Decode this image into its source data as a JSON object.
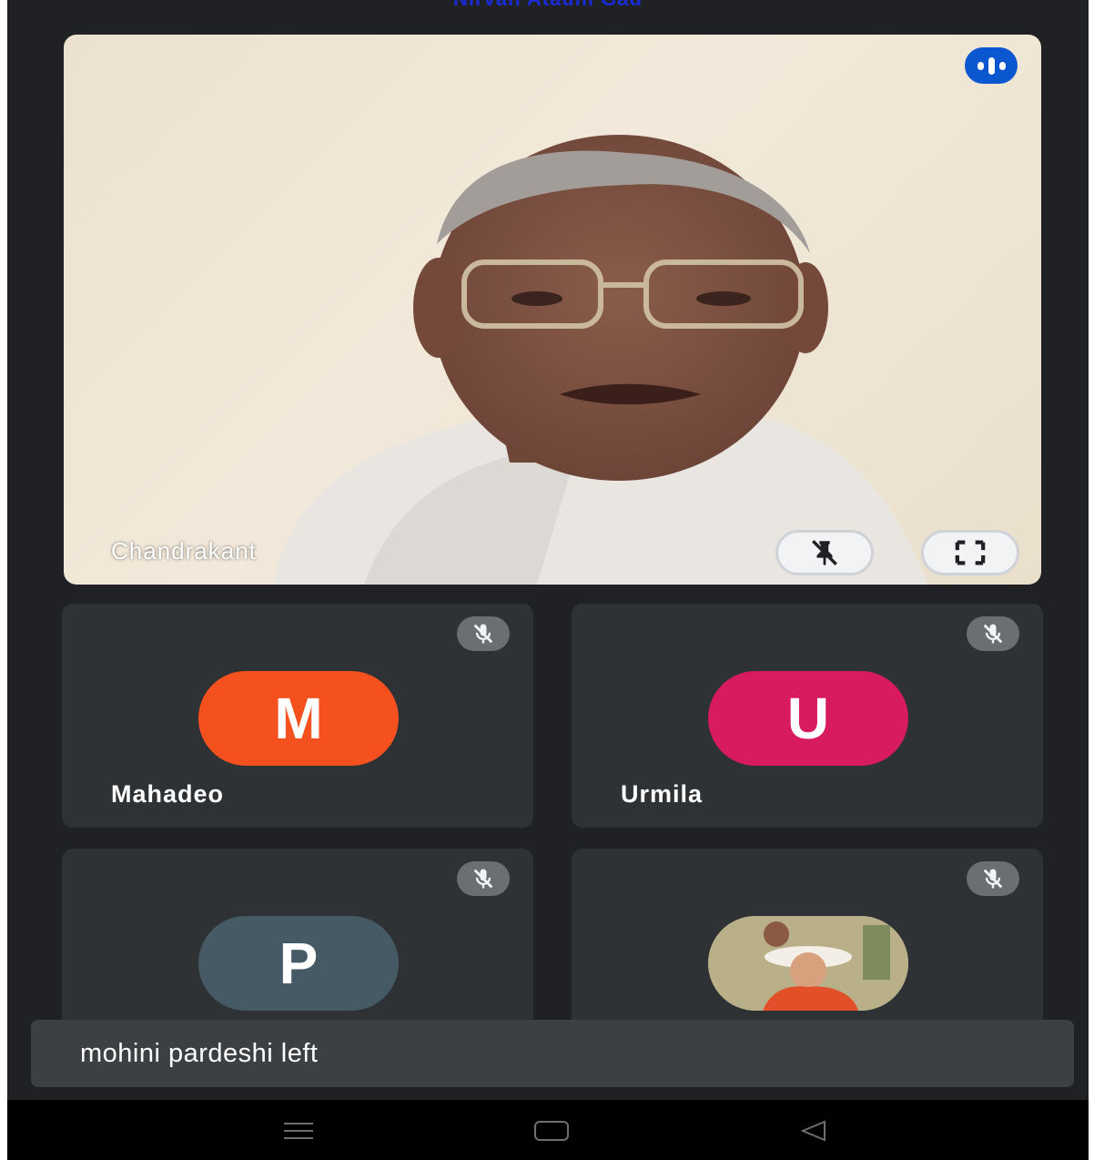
{
  "header": {
    "caption": "Nirvan Ataulli Gad"
  },
  "main_video": {
    "name": "Chandrakant",
    "speaking_icon": "audio-level-icon",
    "pin_icon": "unpin-icon",
    "fullscreen_icon": "fullscreen-icon"
  },
  "participants": [
    {
      "name": "Mahadeo",
      "initial": "M",
      "avatar_color": "#f4511e",
      "muted": true
    },
    {
      "name": "Urmila",
      "initial": "U",
      "avatar_color": "#d81b60",
      "muted": true
    },
    {
      "name": "",
      "initial": "P",
      "avatar_color": "#455a64",
      "muted": true
    },
    {
      "name": "",
      "initial": "",
      "avatar_photo": true,
      "muted": true
    }
  ],
  "toast": {
    "message": "mohini pardeshi left"
  },
  "navbar": {
    "items": [
      "menu-icon",
      "home-icon",
      "back-icon"
    ]
  },
  "colors": {
    "background": "#202124",
    "tile": "#2f3235",
    "speaking": "#0b57d0",
    "toast": "#3c4043"
  }
}
